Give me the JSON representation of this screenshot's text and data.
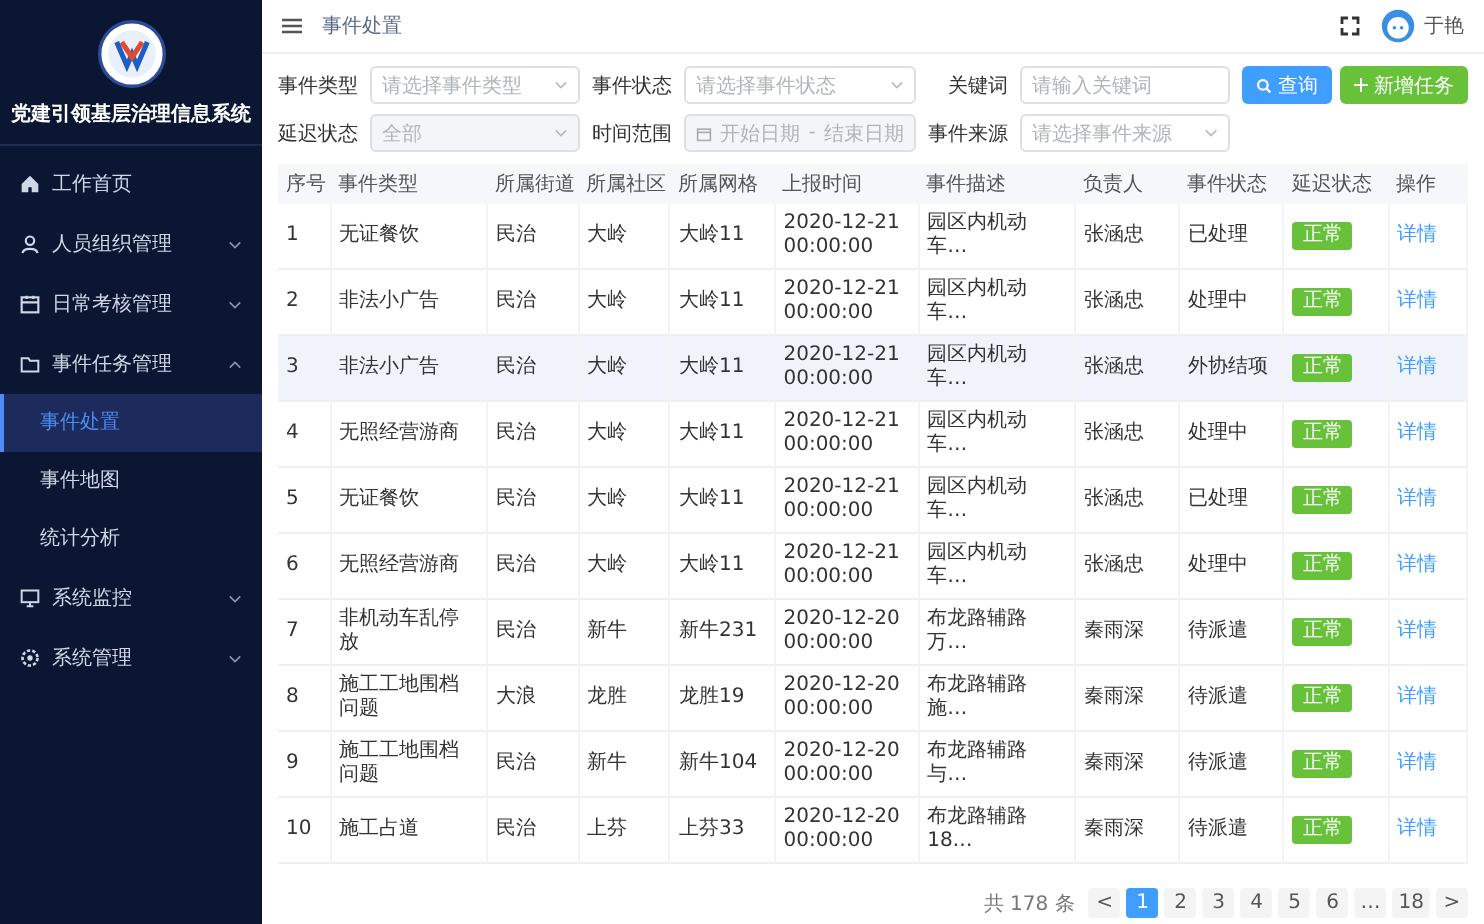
{
  "sidebar": {
    "title": "党建引领基层治理信息系统",
    "items": [
      {
        "label": "工作首页"
      },
      {
        "label": "人员组织管理",
        "expanded": false
      },
      {
        "label": "日常考核管理",
        "expanded": false
      },
      {
        "label": "事件任务管理",
        "expanded": true,
        "children": [
          {
            "label": "事件处置",
            "selected": true
          },
          {
            "label": "事件地图",
            "selected": false
          },
          {
            "label": "统计分析",
            "selected": false
          }
        ]
      },
      {
        "label": "系统监控",
        "expanded": false
      },
      {
        "label": "系统管理",
        "expanded": false
      }
    ]
  },
  "header": {
    "breadcrumb": "事件处置",
    "user": "于艳"
  },
  "filters": [
    {
      "kind": "select",
      "label": "事件类型",
      "placeholder": "请选择事件类型",
      "disabled": false
    },
    {
      "kind": "select",
      "label": "事件状态",
      "placeholder": "请选择事件状态",
      "disabled": false
    },
    {
      "kind": "input",
      "label": "关键词",
      "placeholder": "请输入关键词",
      "disabled": false
    },
    {
      "kind": "select",
      "label": "延迟状态",
      "value": "全部",
      "disabled": true
    },
    {
      "kind": "daterange",
      "label": "时间范围",
      "start_placeholder": "开始日期",
      "separator": "-",
      "end_placeholder": "结束日期",
      "disabled": true
    },
    {
      "kind": "select",
      "label": "事件来源",
      "placeholder": "请选择事件来源",
      "disabled": false
    }
  ],
  "buttons": {
    "search": "查询",
    "add": "新增任务"
  },
  "table": {
    "columns": [
      "序号",
      "事件类型",
      "所属街道",
      "所属社区",
      "所属网格",
      "上报时间",
      "事件描述",
      "负责人",
      "事件状态",
      "延迟状态",
      "操作"
    ],
    "rows": [
      {
        "selected": false,
        "index": "1",
        "type": "无证餐饮",
        "street": "民治",
        "community": "大岭",
        "grid": "大岭11",
        "time": "2020-12-21 00:00:00",
        "desc": "园区内机动车…",
        "owner": "张涵忠",
        "status": "已处理",
        "delay": "正常",
        "action": "详情"
      },
      {
        "selected": false,
        "index": "2",
        "type": "非法小广告",
        "street": "民治",
        "community": "大岭",
        "grid": "大岭11",
        "time": "2020-12-21 00:00:00",
        "desc": "园区内机动车…",
        "owner": "张涵忠",
        "status": "处理中",
        "delay": "正常",
        "action": "详情"
      },
      {
        "selected": true,
        "index": "3",
        "type": "非法小广告",
        "street": "民治",
        "community": "大岭",
        "grid": "大岭11",
        "time": "2020-12-21 00:00:00",
        "desc": "园区内机动车…",
        "owner": "张涵忠",
        "status": "外协结项",
        "delay": "正常",
        "action": "详情"
      },
      {
        "selected": false,
        "index": "4",
        "type": "无照经营游商",
        "street": "民治",
        "community": "大岭",
        "grid": "大岭11",
        "time": "2020-12-21 00:00:00",
        "desc": "园区内机动车…",
        "owner": "张涵忠",
        "status": "处理中",
        "delay": "正常",
        "action": "详情"
      },
      {
        "selected": false,
        "index": "5",
        "type": "无证餐饮",
        "street": "民治",
        "community": "大岭",
        "grid": "大岭11",
        "time": "2020-12-21 00:00:00",
        "desc": "园区内机动车…",
        "owner": "张涵忠",
        "status": "已处理",
        "delay": "正常",
        "action": "详情"
      },
      {
        "selected": false,
        "index": "6",
        "type": "无照经营游商",
        "street": "民治",
        "community": "大岭",
        "grid": "大岭11",
        "time": "2020-12-21 00:00:00",
        "desc": "园区内机动车…",
        "owner": "张涵忠",
        "status": "处理中",
        "delay": "正常",
        "action": "详情"
      },
      {
        "selected": false,
        "index": "7",
        "type": "非机动车乱停放",
        "street": "民治",
        "community": "新牛",
        "grid": "新牛231",
        "time": "2020-12-20 00:00:00",
        "desc": "布龙路辅路万…",
        "owner": "秦雨深",
        "status": "待派遣",
        "delay": "正常",
        "action": "详情"
      },
      {
        "selected": false,
        "index": "8",
        "type": "施工工地围档问题",
        "street": "大浪",
        "community": "龙胜",
        "grid": "龙胜19",
        "time": "2020-12-20 00:00:00",
        "desc": "布龙路辅路施…",
        "owner": "秦雨深",
        "status": "待派遣",
        "delay": "正常",
        "action": "详情"
      },
      {
        "selected": false,
        "index": "9",
        "type": "施工工地围档问题",
        "street": "民治",
        "community": "新牛",
        "grid": "新牛104",
        "time": "2020-12-20 00:00:00",
        "desc": "布龙路辅路与…",
        "owner": "秦雨深",
        "status": "待派遣",
        "delay": "正常",
        "action": "详情"
      },
      {
        "selected": false,
        "index": "10",
        "type": "施工占道",
        "street": "民治",
        "community": "上芬",
        "grid": "上芬33",
        "time": "2020-12-20 00:00:00",
        "desc": "布龙路辅路18…",
        "owner": "秦雨深",
        "status": "待派遣",
        "delay": "正常",
        "action": "详情"
      }
    ]
  },
  "pagination": {
    "total": "共 178 条",
    "prev": "<",
    "pages": [
      {
        "label": "1",
        "selected": true
      },
      {
        "label": "2",
        "selected": false
      },
      {
        "label": "3",
        "selected": false
      },
      {
        "label": "4",
        "selected": false
      },
      {
        "label": "5",
        "selected": false
      },
      {
        "label": "6",
        "selected": false
      },
      {
        "label": "…",
        "selected": false
      },
      {
        "label": "18",
        "selected": false
      }
    ],
    "next": ">"
  }
}
